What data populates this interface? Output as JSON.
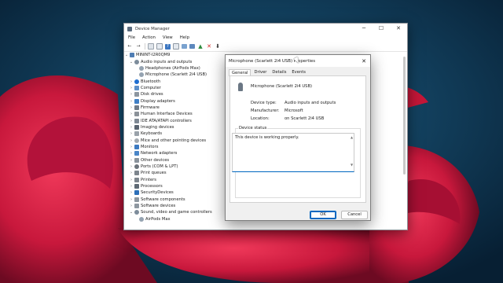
{
  "window": {
    "title": "Device Manager",
    "controls": {
      "minimize": "─",
      "maximize": "☐",
      "close": "✕"
    },
    "menu": [
      "File",
      "Action",
      "View",
      "Help"
    ]
  },
  "toolbar": {
    "icons": [
      "back-icon",
      "forward-icon",
      "properties-icon",
      "list-icon",
      "help-icon",
      "view-icon",
      "computer-icon",
      "monitor-icon",
      "update-driver-icon",
      "uninstall-icon",
      "disable-icon"
    ]
  },
  "tree": {
    "root": "MININT-I2R0QM9",
    "items": [
      {
        "label": "Audio inputs and outputs",
        "expanded": true,
        "children": [
          "Headphones (AirPods Max)",
          "Microphone (Scarlett 2i4 USB)"
        ]
      },
      {
        "label": "Bluetooth"
      },
      {
        "label": "Computer"
      },
      {
        "label": "Disk drives"
      },
      {
        "label": "Display adapters"
      },
      {
        "label": "Firmware"
      },
      {
        "label": "Human Interface Devices"
      },
      {
        "label": "IDE ATA/ATAPI controllers"
      },
      {
        "label": "Imaging devices"
      },
      {
        "label": "Keyboards"
      },
      {
        "label": "Mice and other pointing devices"
      },
      {
        "label": "Monitors"
      },
      {
        "label": "Network adapters"
      },
      {
        "label": "Other devices"
      },
      {
        "label": "Ports (COM & LPT)"
      },
      {
        "label": "Print queues"
      },
      {
        "label": "Printers"
      },
      {
        "label": "Processors"
      },
      {
        "label": "SecurityDevices"
      },
      {
        "label": "Software components"
      },
      {
        "label": "Software devices"
      },
      {
        "label": "Sound, video and game controllers",
        "expanded": true,
        "children": [
          "AirPods Max"
        ]
      }
    ]
  },
  "dialog": {
    "title": "Microphone (Scarlett 2i4 USB) Properties",
    "tabs": [
      "General",
      "Driver",
      "Details",
      "Events"
    ],
    "active_tab": "General",
    "device_name": "Microphone (Scarlett 2i4 USB)",
    "fields": {
      "device_type_label": "Device type:",
      "device_type_value": "Audio inputs and outputs",
      "manufacturer_label": "Manufacturer:",
      "manufacturer_value": "Microsoft",
      "location_label": "Location:",
      "location_value": "on Scarlett 2i4 USB"
    },
    "status_legend": "Device status",
    "status_text": "This device is working properly.",
    "ok": "OK",
    "cancel": "Cancel"
  }
}
